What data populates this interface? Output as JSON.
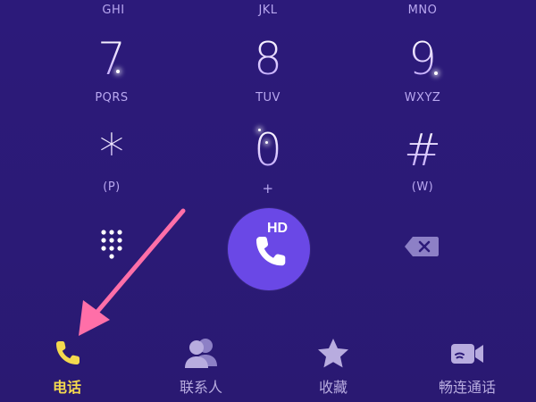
{
  "dialpad": {
    "row_top_letters": [
      "GHI",
      "JKL",
      "MNO"
    ],
    "keys": [
      {
        "digit": "7",
        "letters": "PQRS"
      },
      {
        "digit": "8",
        "letters": "TUV"
      },
      {
        "digit": "9",
        "letters": "WXYZ"
      },
      {
        "digit": "*",
        "letters": "(P)"
      },
      {
        "digit": "0",
        "letters": "+"
      },
      {
        "digit": "#",
        "letters": "(W)"
      }
    ]
  },
  "call_button": {
    "badge": "HD",
    "accent": "#6a48e6"
  },
  "bottom_nav": {
    "items": [
      {
        "label": "电话",
        "icon": "phone-icon",
        "active": true
      },
      {
        "label": "联系人",
        "icon": "contacts-icon",
        "active": false
      },
      {
        "label": "收藏",
        "icon": "star-icon",
        "active": false
      },
      {
        "label": "畅连通话",
        "icon": "video-call-icon",
        "active": false
      }
    ]
  },
  "colors": {
    "background": "#2c1a78",
    "active_tab": "#f4d94e",
    "inactive_tab": "#b8acdf",
    "annotation_arrow": "#ff6fa8"
  }
}
